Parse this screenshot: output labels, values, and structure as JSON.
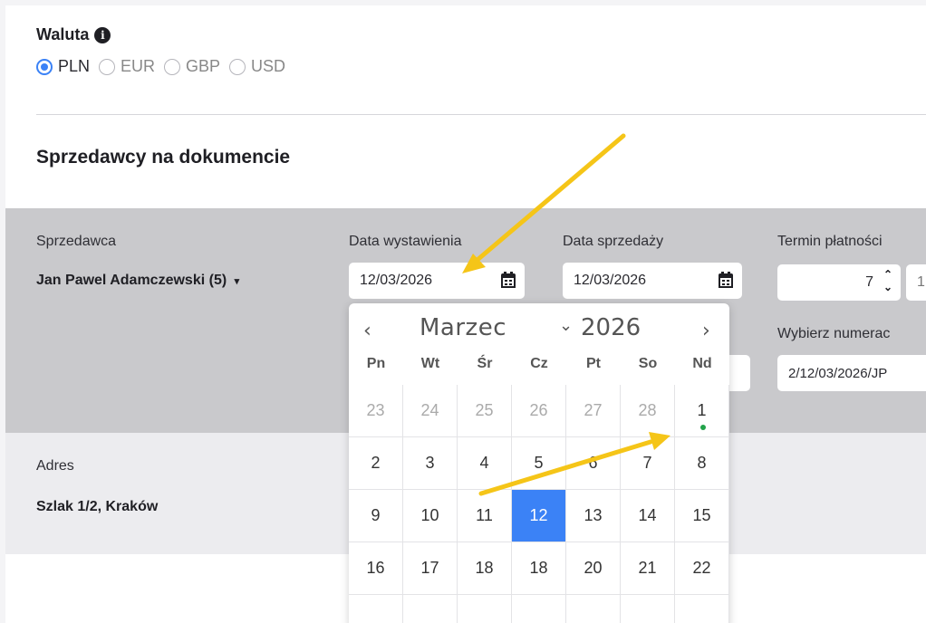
{
  "currency": {
    "title": "Waluta",
    "options": [
      {
        "label": "PLN",
        "checked": true
      },
      {
        "label": "EUR",
        "checked": false
      },
      {
        "label": "GBP",
        "checked": false
      },
      {
        "label": "USD",
        "checked": false
      }
    ]
  },
  "sellers_section": {
    "title": "Sprzedawcy na dokumencie"
  },
  "seller": {
    "label": "Sprzedawca",
    "value": "Jan Pawel Adamczewski (5)"
  },
  "issue_date": {
    "label": "Data wystawienia",
    "value": "12/03/2026"
  },
  "sale_date": {
    "label": "Data sprzedaży",
    "value": "12/03/2026"
  },
  "payment_term": {
    "label": "Termin płatności",
    "value": "7"
  },
  "numbering": {
    "label": "Wybierz numerac",
    "value": "2/12/03/2026/JP"
  },
  "address": {
    "label": "Adres",
    "value": "Szlak 1/2, Kraków"
  },
  "calendar": {
    "prev": "‹",
    "next": "›",
    "month": "Marzec",
    "year": "2026",
    "weekdays": [
      "Pn",
      "Wt",
      "Śr",
      "Cz",
      "Pt",
      "So",
      "Nd"
    ],
    "rows": [
      [
        "23",
        "24",
        "25",
        "26",
        "27",
        "28",
        "1"
      ],
      [
        "2",
        "3",
        "4",
        "5",
        "6",
        "7",
        "8"
      ],
      [
        "9",
        "10",
        "11",
        "12",
        "13",
        "14",
        "15"
      ],
      [
        "16",
        "17",
        "18",
        "18",
        "20",
        "21",
        "22"
      ]
    ],
    "selected": "12",
    "accent_color": "#3b82f6",
    "today_dot_color": "#22a34a"
  },
  "annotation_color": "#f5c518"
}
